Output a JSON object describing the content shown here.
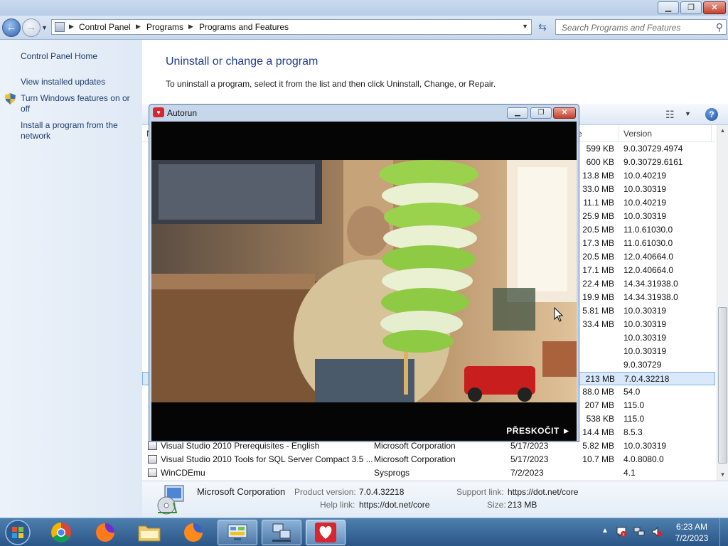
{
  "window": {
    "minimize_label": "▁",
    "maximize_label": "❐",
    "close_label": "✕"
  },
  "address": {
    "crumbs": [
      "Control Panel",
      "Programs",
      "Programs and Features"
    ],
    "search_placeholder": "Search Programs and Features"
  },
  "sidebar": {
    "items": [
      {
        "label": "Control Panel Home"
      },
      {
        "label": "View installed updates"
      },
      {
        "label": "Turn Windows features on or off"
      },
      {
        "label": "Install a program from the network"
      }
    ]
  },
  "main": {
    "title": "Uninstall or change a program",
    "description": "To uninstall a program, select it from the list and then click Uninstall, Change, or Repair.",
    "columns": {
      "name": "N",
      "size": "e",
      "version": "Version"
    },
    "rows": [
      {
        "name": "",
        "publisher": "",
        "installed": "",
        "size": "599 KB",
        "version": "9.0.30729.4974"
      },
      {
        "name": "",
        "publisher": "",
        "installed": "",
        "size": "600 KB",
        "version": "9.0.30729.6161"
      },
      {
        "name": "",
        "publisher": "",
        "installed": "",
        "size": "13.8 MB",
        "version": "10.0.40219"
      },
      {
        "name": "",
        "publisher": "",
        "installed": "",
        "size": "33.0 MB",
        "version": "10.0.30319"
      },
      {
        "name": "",
        "publisher": "",
        "installed": "",
        "size": "11.1 MB",
        "version": "10.0.40219"
      },
      {
        "name": "",
        "publisher": "",
        "installed": "",
        "size": "25.9 MB",
        "version": "10.0.30319"
      },
      {
        "name": "",
        "publisher": "",
        "installed": "",
        "size": "20.5 MB",
        "version": "11.0.61030.0"
      },
      {
        "name": "",
        "publisher": "",
        "installed": "",
        "size": "17.3 MB",
        "version": "11.0.61030.0"
      },
      {
        "name": "",
        "publisher": "",
        "installed": "",
        "size": "20.5 MB",
        "version": "12.0.40664.0"
      },
      {
        "name": "",
        "publisher": "",
        "installed": "",
        "size": "17.1 MB",
        "version": "12.0.40664.0"
      },
      {
        "name": "",
        "publisher": "",
        "installed": "",
        "size": "22.4 MB",
        "version": "14.34.31938.0"
      },
      {
        "name": "",
        "publisher": "",
        "installed": "",
        "size": "19.9 MB",
        "version": "14.34.31938.0"
      },
      {
        "name": "",
        "publisher": "",
        "installed": "",
        "size": "5.81 MB",
        "version": "10.0.30319"
      },
      {
        "name": "",
        "publisher": "",
        "installed": "",
        "size": "33.4 MB",
        "version": "10.0.30319"
      },
      {
        "name": "",
        "publisher": "",
        "installed": "",
        "size": "",
        "version": "10.0.30319"
      },
      {
        "name": "",
        "publisher": "",
        "installed": "",
        "size": "",
        "version": "10.0.30319"
      },
      {
        "name": "",
        "publisher": "",
        "installed": "",
        "size": "",
        "version": "9.0.30729"
      },
      {
        "name": "",
        "publisher": "",
        "installed": "",
        "size": "213 MB",
        "version": "7.0.4.32218"
      },
      {
        "name": "",
        "publisher": "",
        "installed": "",
        "size": "88.0 MB",
        "version": "54.0"
      },
      {
        "name": "",
        "publisher": "",
        "installed": "",
        "size": "207 MB",
        "version": "115.0"
      },
      {
        "name": "",
        "publisher": "",
        "installed": "",
        "size": "538 KB",
        "version": "115.0"
      },
      {
        "name": "",
        "publisher": "",
        "installed": "",
        "size": "14.4 MB",
        "version": "8.5.3"
      },
      {
        "name": "Visual Studio 2010 Prerequisites - English",
        "publisher": "Microsoft Corporation",
        "installed": "5/17/2023",
        "size": "5.82 MB",
        "version": "10.0.30319"
      },
      {
        "name": "Visual Studio 2010 Tools for SQL Server Compact 3.5 ...",
        "publisher": "Microsoft Corporation",
        "installed": "5/17/2023",
        "size": "10.7 MB",
        "version": "4.0.8080.0"
      },
      {
        "name": "WinCDEmu",
        "publisher": "Sysprogs",
        "installed": "7/2/2023",
        "size": "",
        "version": "4.1"
      }
    ],
    "selected_row_index": 17
  },
  "details": {
    "publisher": "Microsoft Corporation",
    "product_version_label": "Product version:",
    "product_version": "7.0.4.32218",
    "help_link_label": "Help link:",
    "help_link": "https://dot.net/core",
    "support_link_label": "Support link:",
    "support_link": "https://dot.net/core",
    "size_label": "Size:",
    "size": "213 MB"
  },
  "autorun": {
    "title": "Autorun",
    "skip_label": "PŘESKOČIT ►",
    "icon_text": "♥"
  },
  "taskbar": {
    "clock_time": "6:23 AM",
    "clock_date": "7/2/2023",
    "items": [
      "chrome-icon",
      "firefox-icon",
      "explorer-icon",
      "firefox-icon",
      "control-panel-icon",
      "network-icon",
      "autorun-icon"
    ]
  },
  "colors": {
    "link": "#1e3d6e",
    "heading": "#1e3d8f",
    "selection": "#d9e9fb"
  }
}
